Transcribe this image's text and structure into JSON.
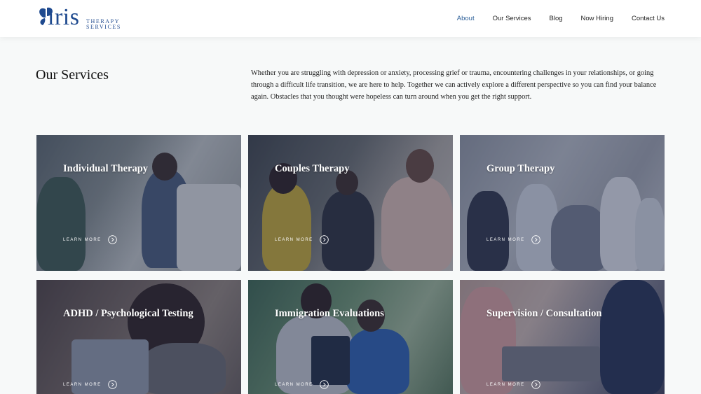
{
  "header": {
    "logo": {
      "word": "iris",
      "sub_line1": "THERAPY",
      "sub_line2": "SERVICES"
    },
    "nav": [
      "About",
      "Our Services",
      "Blog",
      "Now Hiring",
      "Contact Us"
    ],
    "active_nav": "About"
  },
  "page": {
    "title": "Our Services",
    "intro": "Whether you are struggling with depression or anxiety, processing grief or trauma, encountering challenges in your relationships, or going through a difficult life transition, we are here to help. Together we can actively explore a different perspective so you can find your balance again. Obstacles that you thought were hopeless can turn around when you get the right support."
  },
  "cards": [
    {
      "title": "Individual Therapy",
      "cta": "LEARN MORE"
    },
    {
      "title": "Couples Therapy",
      "cta": "LEARN MORE"
    },
    {
      "title": "Group Therapy",
      "cta": "LEARN MORE"
    },
    {
      "title": "ADHD / Psychological Testing",
      "cta": "LEARN MORE"
    },
    {
      "title": "Immigration Evaluations",
      "cta": "LEARN MORE"
    },
    {
      "title": "Supervision / Consultation",
      "cta": "LEARN MORE"
    }
  ],
  "colors": {
    "brand": "#1f4a8f",
    "active_nav": "#2b5e98",
    "overlay": "#232d4e",
    "background": "#f7f9f9"
  },
  "icons": [
    "iris-flower-icon",
    "chevron-right-circle-icon"
  ]
}
